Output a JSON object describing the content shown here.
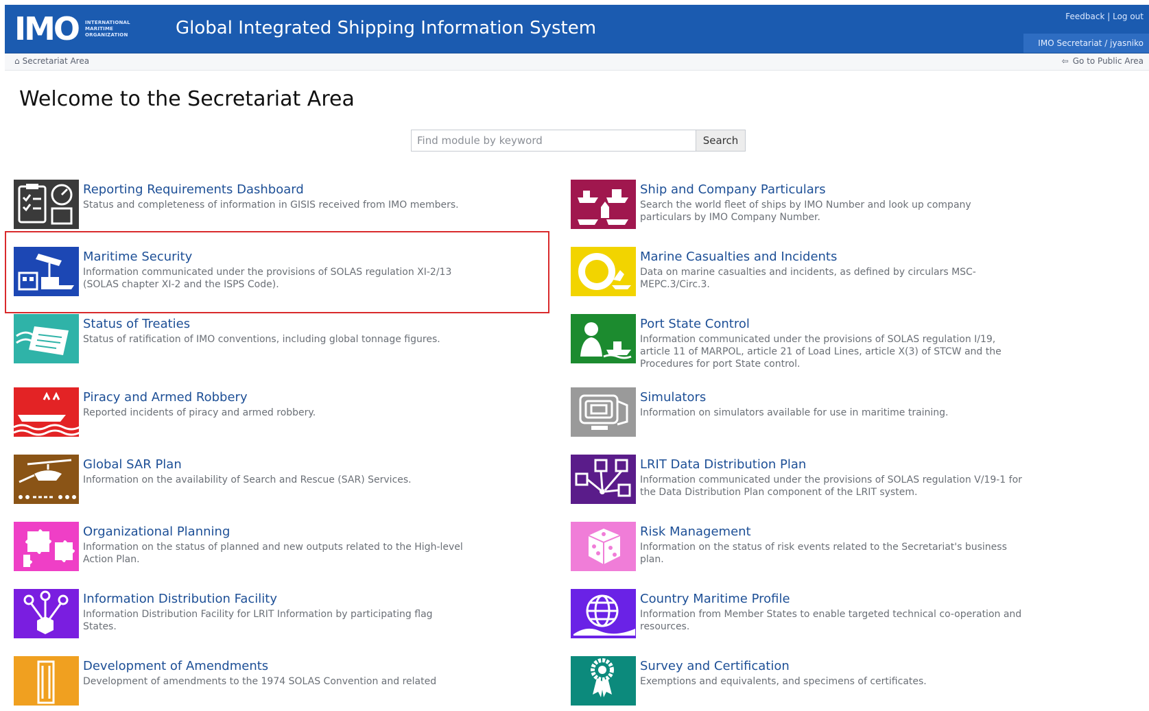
{
  "header": {
    "logo_text": "IMO",
    "logo_subtext": "INTERNATIONAL MARITIME ORGANIZATION",
    "title": "Global Integrated Shipping Information System",
    "links": [
      "Feedback",
      "Log out"
    ],
    "user": "IMO Secretariat / jyasniko"
  },
  "subbar": {
    "breadcrumb": "Secretariat Area",
    "public_link": "Go to Public Area"
  },
  "page_title": "Welcome to the Secretariat Area",
  "search": {
    "placeholder": "Find module by keyword",
    "button": "Search"
  },
  "modules": [
    {
      "name": "Reporting Requirements Dashboard",
      "desc": "Status and completeness of information in GISIS received from IMO members.",
      "color": "#3a3a3a"
    },
    {
      "name": "Ship and Company Particulars",
      "desc": "Search the world fleet of ships by IMO Number and look up company particulars by IMO Company Number.",
      "color": "#a0174e"
    },
    {
      "name": "Maritime Security",
      "desc": "Information communicated under the provisions of SOLAS regulation XI-2/13 (SOLAS chapter XI-2 and the ISPS Code).",
      "color": "#1c47b4"
    },
    {
      "name": "Marine Casualties and Incidents",
      "desc": "Data on marine casualties and incidents, as defined by circulars MSC-MEPC.3/Circ.3.",
      "color": "#f2d400"
    },
    {
      "name": "Status of Treaties",
      "desc": "Status of ratification of IMO conventions, including global tonnage figures.",
      "color": "#2fb3a8"
    },
    {
      "name": "Port State Control",
      "desc": "Information communicated under the provisions of SOLAS regulation I/19, article 11 of MARPOL, article 21 of Load Lines, article X(3) of STCW and the Procedures for port State control.",
      "color": "#1c8b2f"
    },
    {
      "name": "Piracy and Armed Robbery",
      "desc": "Reported incidents of piracy and armed robbery.",
      "color": "#e32325"
    },
    {
      "name": "Simulators",
      "desc": "Information on simulators available for use in maritime training.",
      "color": "#9a9a9a"
    },
    {
      "name": "Global SAR Plan",
      "desc": "Information on the availability of Search and Rescue (SAR) Services.",
      "color": "#8a5416"
    },
    {
      "name": "LRIT Data Distribution Plan",
      "desc": "Information communicated under the provisions of SOLAS regulation V/19-1 for the Data Distribution Plan component of the LRIT system.",
      "color": "#5a1c8a"
    },
    {
      "name": "Organizational Planning",
      "desc": "Information on the status of planned and new outputs related to the High-level Action Plan.",
      "color": "#ef3fc6"
    },
    {
      "name": "Risk Management",
      "desc": "Information on the status of risk events related to the Secretariat's business plan.",
      "color": "#f07dd8"
    },
    {
      "name": "Information Distribution Facility",
      "desc": "Information Distribution Facility for LRIT Information by participating flag States.",
      "color": "#7a1ee0"
    },
    {
      "name": "Country Maritime Profile",
      "desc": "Information from Member States to enable targeted technical co-operation and resources.",
      "color": "#6a22e6"
    },
    {
      "name": "Development of Amendments",
      "desc": "Development of amendments to the 1974 SOLAS Convention and related",
      "color": "#f0a020"
    },
    {
      "name": "Survey and Certification",
      "desc": "Exemptions and equivalents, and specimens of certificates.",
      "color": "#0c8a7c"
    }
  ]
}
